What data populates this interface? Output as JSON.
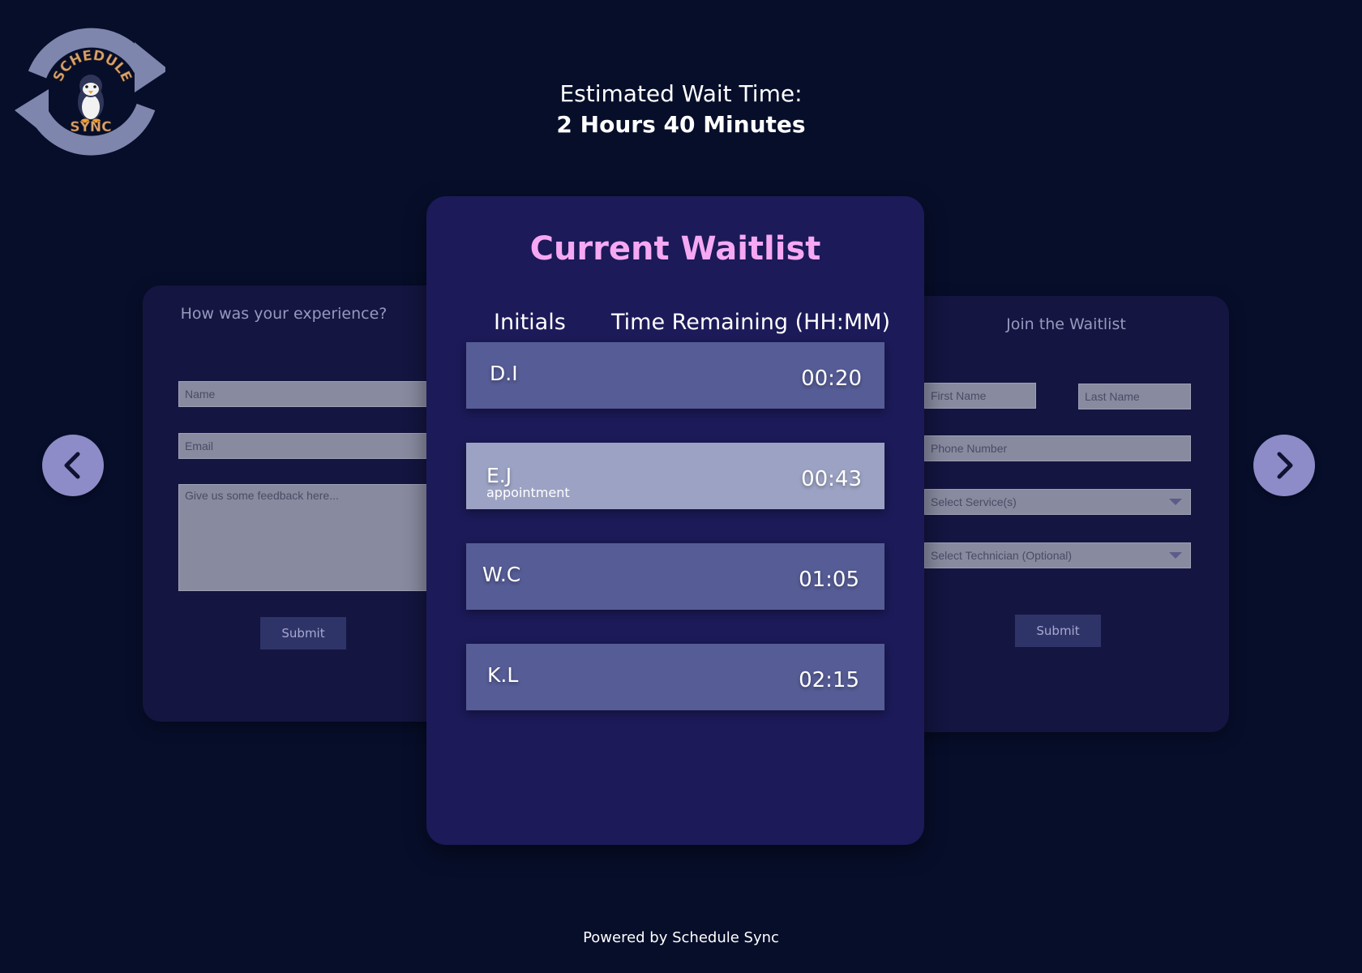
{
  "logo": {
    "text_top": "SCHEDULE",
    "text_bottom": "SYNC",
    "icon": "penguin-sync-logo"
  },
  "header": {
    "wait_label": "Estimated Wait Time:",
    "wait_value": "2 Hours 40 Minutes"
  },
  "feedback_form": {
    "title": "How was your experience?",
    "name_placeholder": "Name",
    "email_placeholder": "Email",
    "feedback_placeholder": "Give us some feedback here...",
    "submit_label": "Submit"
  },
  "waitlist": {
    "title": "Current Waitlist",
    "col_initials": "Initials",
    "col_time": "Time Remaining (HH:MM)",
    "rows": [
      {
        "initials": "D.I",
        "time": "00:20",
        "note": ""
      },
      {
        "initials": "E.J",
        "time": "00:43",
        "note": "appointment"
      },
      {
        "initials": "W.C",
        "time": "01:05",
        "note": ""
      },
      {
        "initials": "K.L",
        "time": "02:15",
        "note": ""
      }
    ]
  },
  "join_form": {
    "title": "Join the Waitlist",
    "first_name_placeholder": "First Name",
    "last_name_placeholder": "Last Name",
    "phone_placeholder": "Phone Number",
    "service_placeholder": "Select Service(s)",
    "technician_placeholder": "Select Technician (Optional)",
    "submit_label": "Submit"
  },
  "nav": {
    "prev_icon": "chevron-left-icon",
    "next_icon": "chevron-right-icon"
  },
  "footer": {
    "text": "Powered by Schedule Sync"
  },
  "colors": {
    "background": "#070e2a",
    "main_card": "#1c1a58",
    "side_card": "#141540",
    "title_accent": "#f6a8f3",
    "row": "#565c95",
    "row_highlight": "#9ca2c3",
    "nav_button": "#8d8bc8"
  }
}
